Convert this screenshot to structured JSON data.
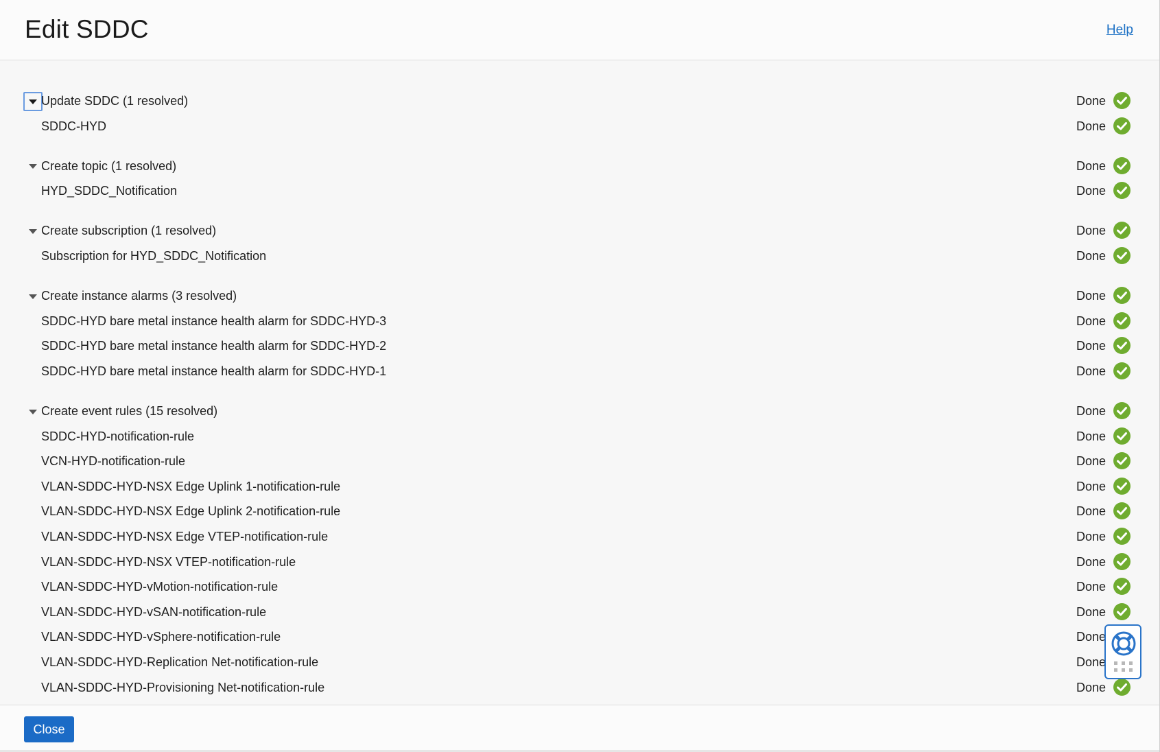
{
  "dialog": {
    "title": "Edit SDDC",
    "help_label": "Help",
    "close_label": "Close"
  },
  "colors": {
    "accent": "#1b6bc6",
    "success": "#6fac2f",
    "link": "#1a6fc4"
  },
  "groups": [
    {
      "label": "Update SDDC (1 resolved)",
      "status": "Done",
      "items": [
        {
          "label": "SDDC-HYD",
          "status": "Done"
        }
      ]
    },
    {
      "label": "Create topic (1 resolved)",
      "status": "Done",
      "items": [
        {
          "label": "HYD_SDDC_Notification",
          "status": "Done"
        }
      ]
    },
    {
      "label": "Create subscription (1 resolved)",
      "status": "Done",
      "items": [
        {
          "label": "Subscription for HYD_SDDC_Notification",
          "status": "Done"
        }
      ]
    },
    {
      "label": "Create instance alarms (3 resolved)",
      "status": "Done",
      "items": [
        {
          "label": "SDDC-HYD bare metal instance health alarm for SDDC-HYD-3",
          "status": "Done"
        },
        {
          "label": "SDDC-HYD bare metal instance health alarm for SDDC-HYD-2",
          "status": "Done"
        },
        {
          "label": "SDDC-HYD bare metal instance health alarm for SDDC-HYD-1",
          "status": "Done"
        }
      ]
    },
    {
      "label": "Create event rules (15 resolved)",
      "status": "Done",
      "items": [
        {
          "label": "SDDC-HYD-notification-rule",
          "status": "Done"
        },
        {
          "label": "VCN-HYD-notification-rule",
          "status": "Done"
        },
        {
          "label": "VLAN-SDDC-HYD-NSX Edge Uplink 1-notification-rule",
          "status": "Done"
        },
        {
          "label": "VLAN-SDDC-HYD-NSX Edge Uplink 2-notification-rule",
          "status": "Done"
        },
        {
          "label": "VLAN-SDDC-HYD-NSX Edge VTEP-notification-rule",
          "status": "Done"
        },
        {
          "label": "VLAN-SDDC-HYD-NSX VTEP-notification-rule",
          "status": "Done"
        },
        {
          "label": "VLAN-SDDC-HYD-vMotion-notification-rule",
          "status": "Done"
        },
        {
          "label": "VLAN-SDDC-HYD-vSAN-notification-rule",
          "status": "Done"
        },
        {
          "label": "VLAN-SDDC-HYD-vSphere-notification-rule",
          "status": "Done"
        },
        {
          "label": "VLAN-SDDC-HYD-Replication Net-notification-rule",
          "status": "Done"
        },
        {
          "label": "VLAN-SDDC-HYD-Provisioning Net-notification-rule",
          "status": "Done"
        }
      ]
    }
  ]
}
